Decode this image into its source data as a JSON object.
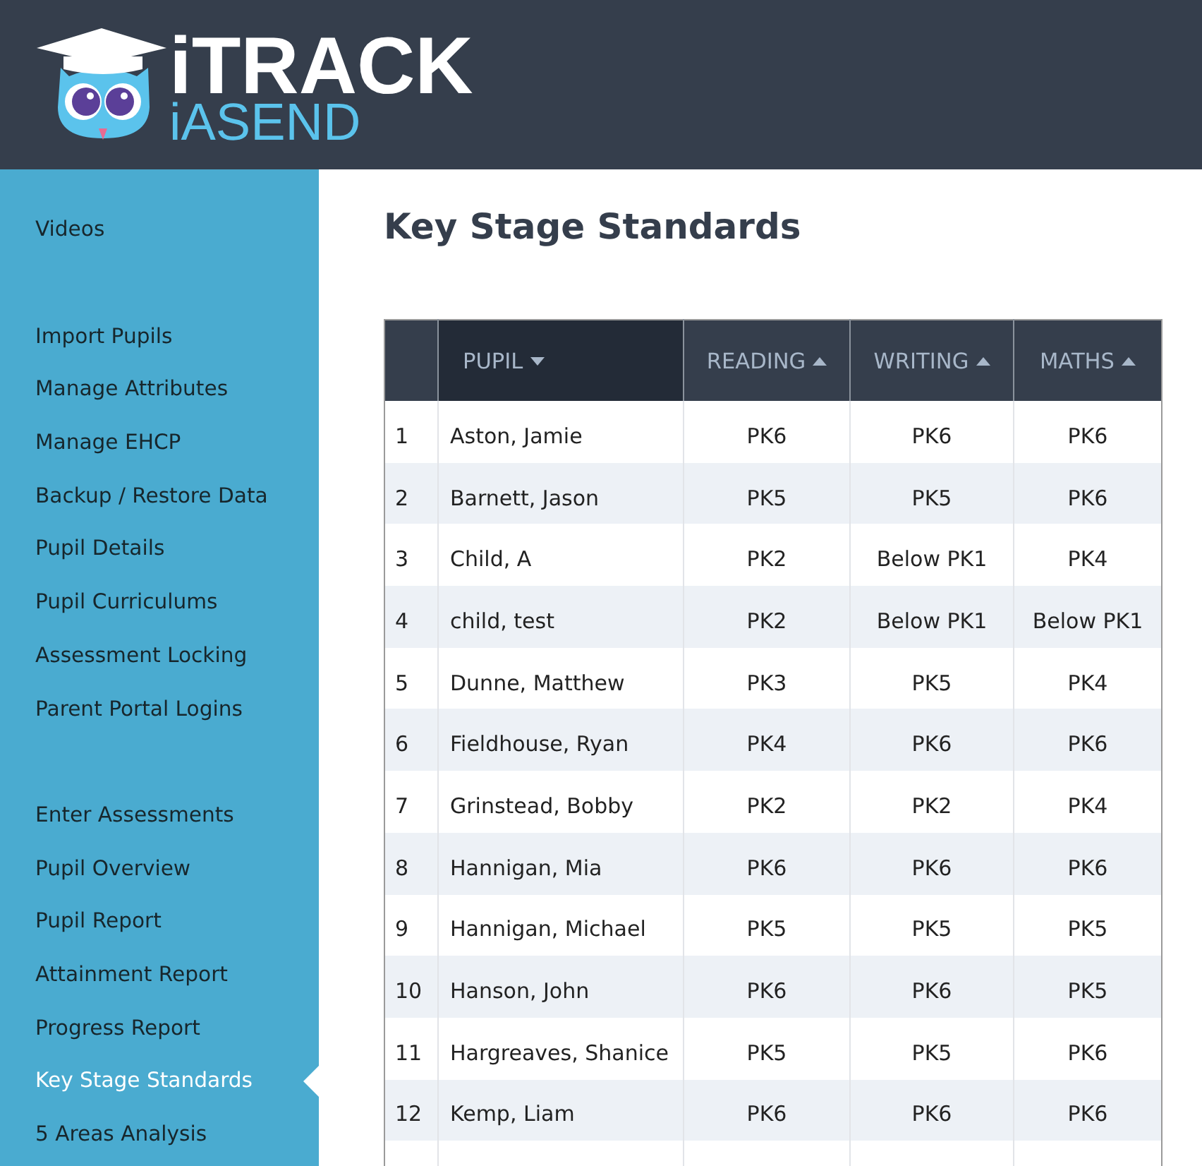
{
  "logo": {
    "title": "iTRACK",
    "subtitle": "iASEND"
  },
  "sidebar": {
    "groups": [
      {
        "items": [
          {
            "label": "Videos",
            "selected": false
          }
        ]
      },
      {
        "items": [
          {
            "label": "Import Pupils",
            "selected": false
          },
          {
            "label": "Manage Attributes",
            "selected": false
          },
          {
            "label": "Manage EHCP",
            "selected": false
          },
          {
            "label": "Backup / Restore Data",
            "selected": false
          },
          {
            "label": "Pupil Details",
            "selected": false
          },
          {
            "label": "Pupil Curriculums",
            "selected": false
          },
          {
            "label": "Assessment Locking",
            "selected": false
          },
          {
            "label": "Parent Portal Logins",
            "selected": false
          }
        ]
      },
      {
        "items": [
          {
            "label": "Enter Assessments",
            "selected": false
          },
          {
            "label": "Pupil Overview",
            "selected": false
          },
          {
            "label": "Pupil Report",
            "selected": false
          },
          {
            "label": "Attainment Report",
            "selected": false
          },
          {
            "label": "Progress Report",
            "selected": false
          },
          {
            "label": "Key Stage Standards",
            "selected": true
          },
          {
            "label": "5 Areas Analysis",
            "selected": false
          }
        ]
      }
    ]
  },
  "page_title": "Key Stage Standards",
  "table": {
    "columns": [
      {
        "label": "PUPIL",
        "descending": true,
        "selected": true
      },
      {
        "label": "READING",
        "descending": false,
        "selected": false
      },
      {
        "label": "WRITING",
        "descending": false,
        "selected": false
      },
      {
        "label": "MATHS",
        "descending": false,
        "selected": false
      }
    ],
    "rows": [
      {
        "number": "1",
        "pupil": "Aston, Jamie",
        "reading": "PK6",
        "writing": "PK6",
        "maths": "PK6"
      },
      {
        "number": "2",
        "pupil": "Barnett, Jason",
        "reading": "PK5",
        "writing": "PK5",
        "maths": "PK6"
      },
      {
        "number": "3",
        "pupil": "Child, A",
        "reading": "PK2",
        "writing": "Below PK1",
        "maths": "PK4"
      },
      {
        "number": "4",
        "pupil": "child, test",
        "reading": "PK2",
        "writing": "Below PK1",
        "maths": "Below PK1"
      },
      {
        "number": "5",
        "pupil": "Dunne, Matthew",
        "reading": "PK3",
        "writing": "PK5",
        "maths": "PK4"
      },
      {
        "number": "6",
        "pupil": "Fieldhouse, Ryan",
        "reading": "PK4",
        "writing": "PK6",
        "maths": "PK6"
      },
      {
        "number": "7",
        "pupil": "Grinstead, Bobby",
        "reading": "PK2",
        "writing": "PK2",
        "maths": "PK4"
      },
      {
        "number": "8",
        "pupil": "Hannigan, Mia",
        "reading": "PK6",
        "writing": "PK6",
        "maths": "PK6"
      },
      {
        "number": "9",
        "pupil": "Hannigan, Michael",
        "reading": "PK5",
        "writing": "PK5",
        "maths": "PK5"
      },
      {
        "number": "10",
        "pupil": "Hanson, John",
        "reading": "PK6",
        "writing": "PK6",
        "maths": "PK5"
      },
      {
        "number": "11",
        "pupil": "Hargreaves, Shanice",
        "reading": "PK5",
        "writing": "PK5",
        "maths": "PK6"
      },
      {
        "number": "12",
        "pupil": "Kemp, Liam",
        "reading": "PK6",
        "writing": "PK6",
        "maths": "PK6"
      }
    ]
  }
}
